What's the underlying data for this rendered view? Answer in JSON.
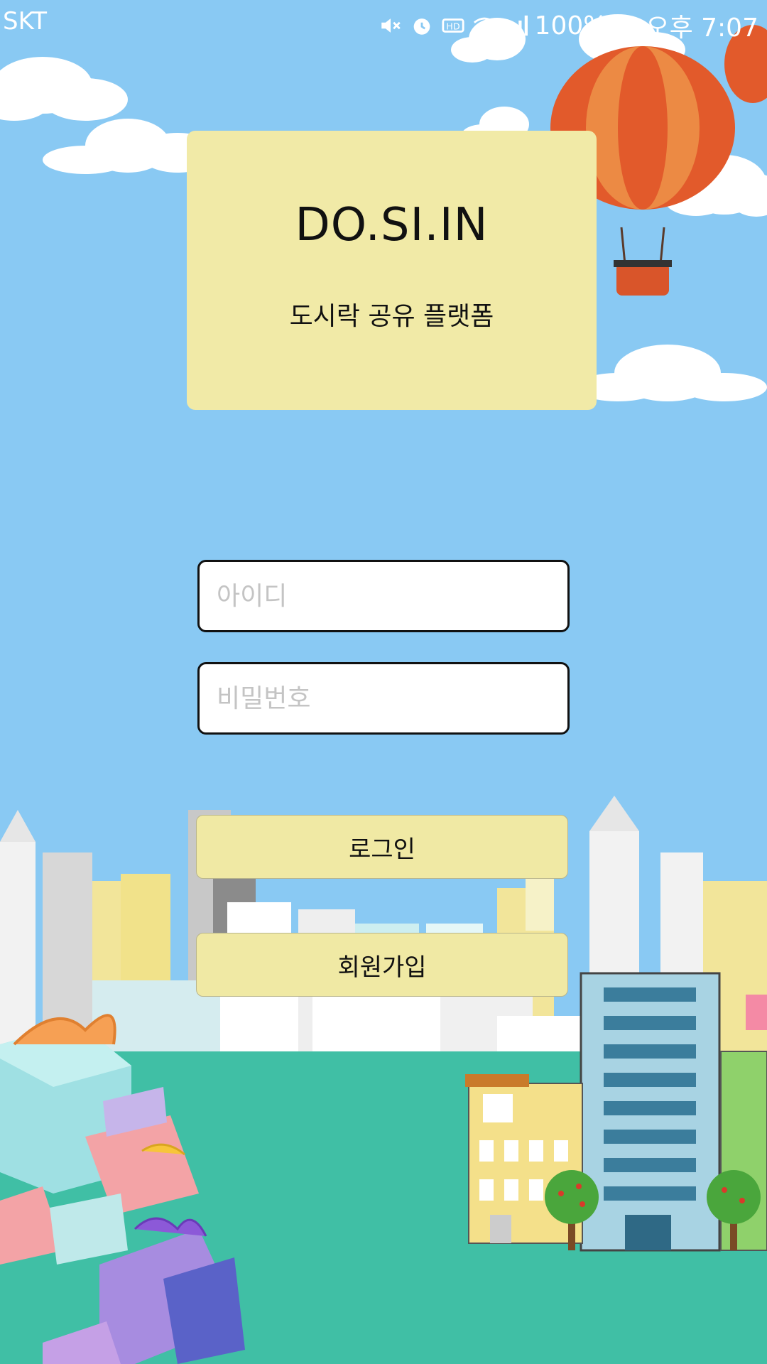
{
  "status_bar": {
    "carrier": "SKT",
    "icons": [
      "mute-icon",
      "alarm-icon",
      "hd-icon",
      "wifi-icon",
      "signal-icon",
      "battery-icon"
    ],
    "battery": "100%",
    "time": "오후 7:07"
  },
  "logo": {
    "title": "DO.SI.IN",
    "subtitle": "도시락 공유 플랫폼"
  },
  "login_form": {
    "id_placeholder": "아이디",
    "password_placeholder": "비밀번호",
    "login_label": "로그인",
    "signup_label": "회원가입"
  },
  "colors": {
    "sky": "#89c9f3",
    "card": "#f1eaa7",
    "button": "#f0e9a4",
    "ground": "#40bfa5",
    "balloon_orange": "#e25a2b"
  }
}
